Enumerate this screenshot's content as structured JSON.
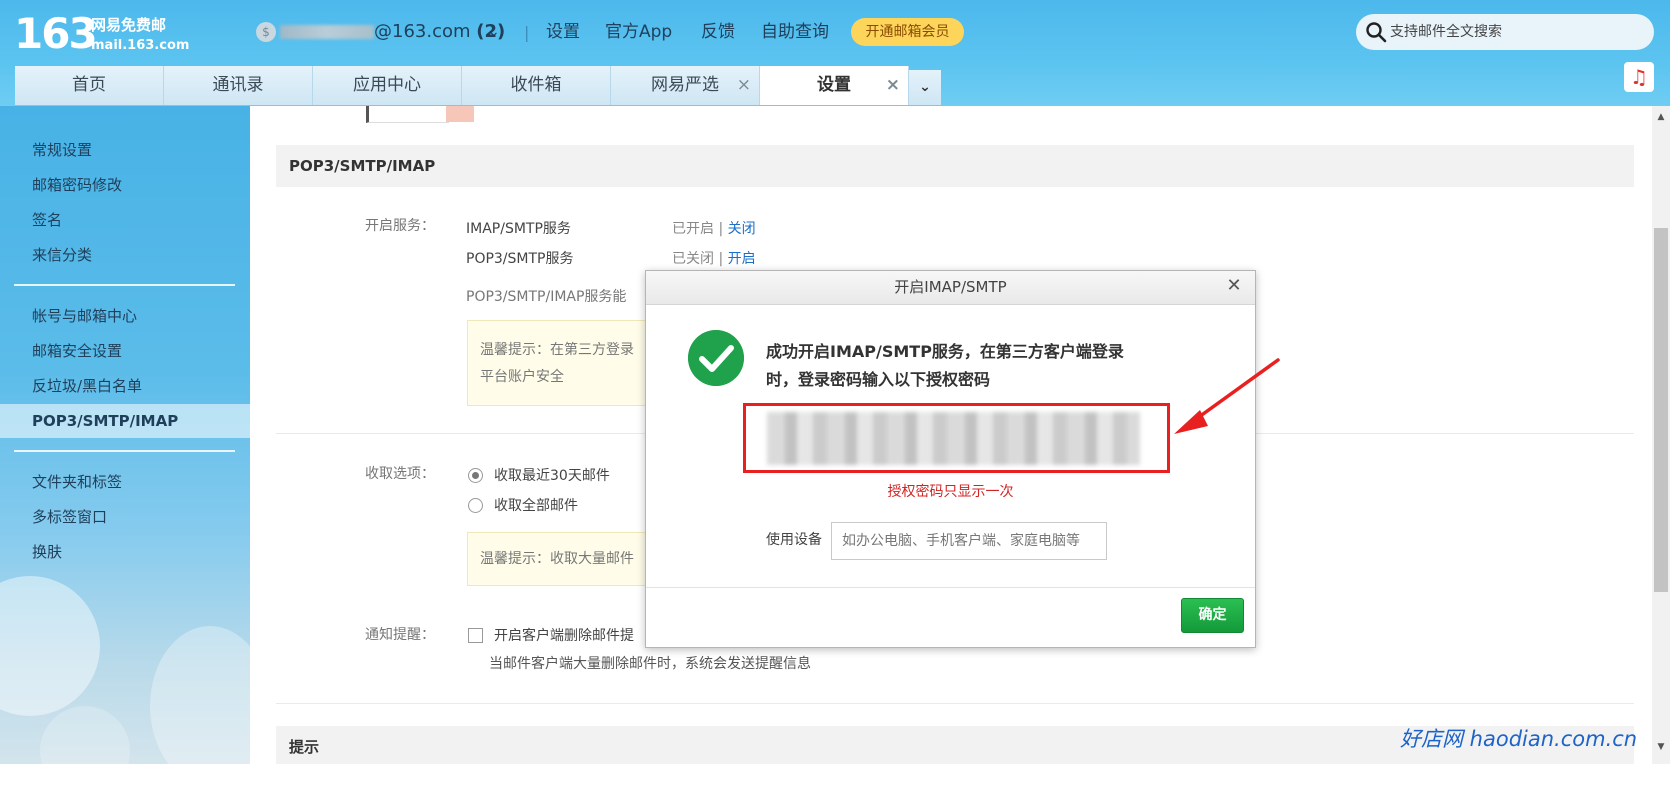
{
  "header": {
    "logo_number": "163",
    "logo_name": "网易免费邮",
    "logo_domain": "mail.163.com",
    "account_icon": "$",
    "account_suffix": "@163.com",
    "account_count": "(2)",
    "nav_links": [
      "设置",
      "官方App",
      "反馈",
      "自助查询"
    ],
    "vip_button": "开通邮箱会员",
    "search_placeholder": "支持邮件全文搜索"
  },
  "tabs": [
    {
      "label": "首页"
    },
    {
      "label": "通讯录"
    },
    {
      "label": "应用中心"
    },
    {
      "label": "收件箱"
    },
    {
      "label": "网易严选",
      "closable": true
    },
    {
      "label": "设置",
      "closable": true,
      "active": true
    }
  ],
  "sidebar": {
    "group1": [
      "常规设置",
      "邮箱密码修改",
      "签名",
      "来信分类"
    ],
    "group2": [
      "帐号与邮箱中心",
      "邮箱安全设置",
      "反垃圾/黑白名单",
      "POP3/SMTP/IMAP"
    ],
    "group3": [
      "文件夹和标签",
      "多标签窗口",
      "换肤"
    ],
    "active_item": "POP3/SMTP/IMAP"
  },
  "section": {
    "title": "POP3/SMTP/IMAP",
    "service_label": "开启服务：",
    "imap_name": "IMAP/SMTP服务",
    "imap_status": "已开启",
    "imap_sep": "|",
    "imap_action": "关闭",
    "pop_name": "POP3/SMTP服务",
    "pop_status": "已关闭",
    "pop_sep": "|",
    "pop_action": "开启",
    "service_desc": "POP3/SMTP/IMAP服务能",
    "tip1_line1": "温馨提示：在第三方登录",
    "tip1_line2": "平台账户安全",
    "receive_label": "收取选项：",
    "receive_opt1": "收取最近30天邮件",
    "receive_opt2": "收取全部邮件",
    "tip2": "温馨提示：收取大量邮件",
    "notify_label": "通知提醒：",
    "notify_opt": "开启客户端删除邮件提",
    "notify_desc": "当邮件客户端大量删除邮件时，系统会发送提醒信息",
    "next_title": "提示"
  },
  "dialog": {
    "title": "开启IMAP/SMTP",
    "message": "成功开启IMAP/SMTP服务，在第三方客户端登录时，登录密码输入以下授权密码",
    "code_note": "授权密码只显示一次",
    "device_label": "使用设备",
    "device_placeholder": "如办公电脑、手机客户端、家庭电脑等",
    "confirm_button": "确定"
  },
  "watermark": "好店网 haodian.com.cn",
  "colors": {
    "header_blue": "#4cb8ec",
    "vip_yellow": "#fcd55a",
    "link_blue": "#1a6fc9",
    "success_green": "#1fa24b",
    "alert_red": "#e82020"
  }
}
